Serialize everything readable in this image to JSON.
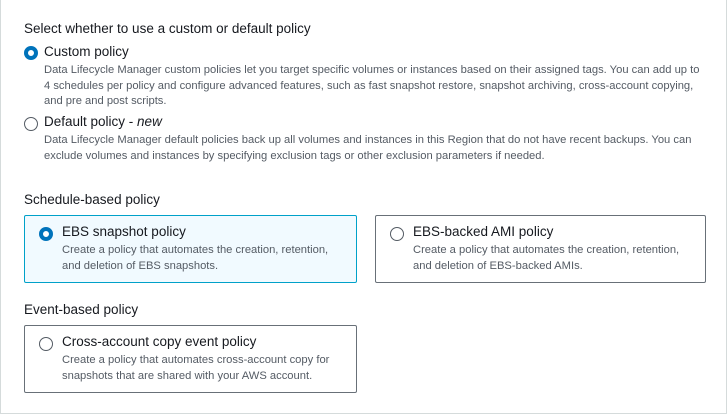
{
  "policy_type": {
    "title": "Select whether to use a custom or default policy",
    "custom": {
      "label": "Custom policy",
      "selected": true,
      "description": "Data Lifecycle Manager custom policies let you target specific volumes or instances based on their assigned tags. You can add up to 4 schedules per policy and configure advanced features, such as fast snapshot restore, snapshot archiving, cross-account copying, and pre and post scripts."
    },
    "default": {
      "label": "Default policy - ",
      "label_badge": "new",
      "selected": false,
      "description": "Data Lifecycle Manager default policies back up all volumes and instances in this Region that do not have recent backups. You can exclude volumes and instances by specifying exclusion tags or other exclusion parameters if needed."
    }
  },
  "schedule_based": {
    "title": "Schedule-based policy",
    "options": [
      {
        "label": "EBS snapshot policy",
        "description": "Create a policy that automates the creation, retention, and deletion of EBS snapshots.",
        "selected": true
      },
      {
        "label": "EBS-backed AMI policy",
        "description": "Create a policy that automates the creation, retention, and deletion of EBS-backed AMIs.",
        "selected": false
      }
    ]
  },
  "event_based": {
    "title": "Event-based policy",
    "options": [
      {
        "label": "Cross-account copy event policy",
        "description": "Create a policy that automates cross-account copy for snapshots that are shared with your AWS account.",
        "selected": false
      }
    ]
  },
  "colors": {
    "accent": "#0073bb",
    "selected_card_border": "#00a1c9",
    "selected_card_bg": "#f1faff",
    "text": "#16191f",
    "muted": "#545b64"
  }
}
